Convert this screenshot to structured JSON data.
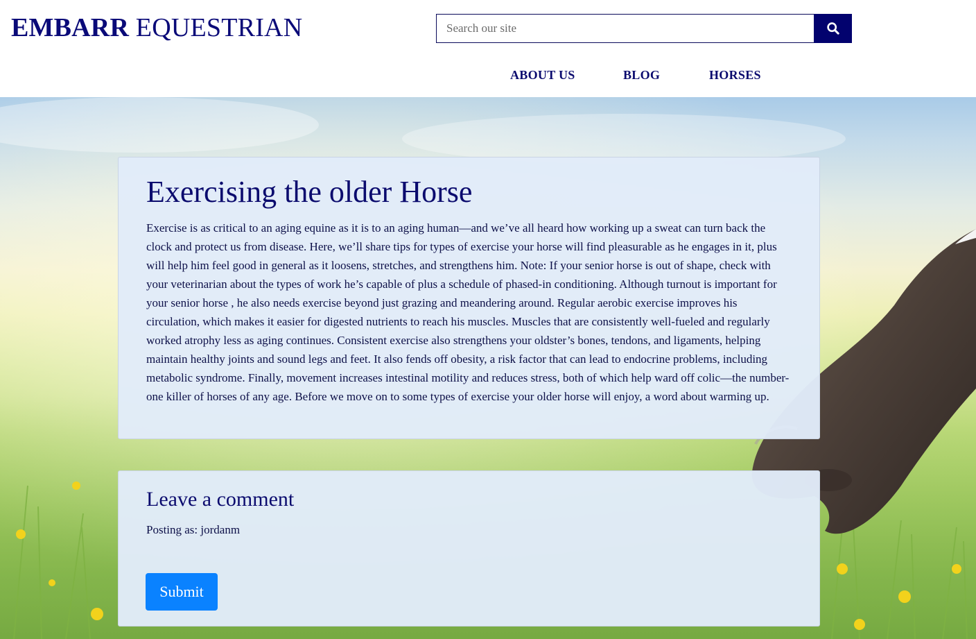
{
  "header": {
    "logo_bold": "EMBARR",
    "logo_light": " EQUESTRIAN",
    "search": {
      "placeholder": "Search our site",
      "value": "",
      "button_icon": "search-icon"
    },
    "nav": {
      "about": "ABOUT US",
      "blog": "BLOG",
      "horses": "HORSES"
    }
  },
  "article": {
    "title": "Exercising the older Horse",
    "body": "Exercise is as critical to an aging equine as it is to an aging human—and we’ve all heard how working up a sweat can turn back the clock and protect us from disease. Here, we’ll share tips for types of exercise your horse will find pleasurable as he engages in it, plus will help him feel good in general as it loosens, stretches, and strengthens him. Note: If your senior horse is out of shape, check with your veterinarian about the types of work he’s capable of plus a schedule of phased-in conditioning. Although turnout is important for your senior horse , he also needs exercise beyond just grazing and meandering around. Regular aerobic exercise improves his circulation, which makes it easier for digested nutrients to reach his muscles. Muscles that are consistently well-fueled and regularly worked atrophy less as aging continues. Consistent exercise also strengthens your oldster’s bones, tendons, and ligaments, helping maintain healthy joints and sound legs and feet. It also fends off obesity, a risk factor that can lead to endocrine problems, including metabolic syndrome. Finally, movement increases intestinal motility and reduces stress, both of which help ward off colic—the number-one killer of horses of any age. Before we move on to some types of exercise your older horse will enjoy, a word about warming up."
  },
  "comment": {
    "title": "Leave a comment",
    "posting_as": "Posting as: jordanm",
    "submit_label": "Submit"
  },
  "colors": {
    "brand_navy": "#02026e",
    "submit_blue": "#0a82ff",
    "card_bg": "#e1ebf9"
  }
}
